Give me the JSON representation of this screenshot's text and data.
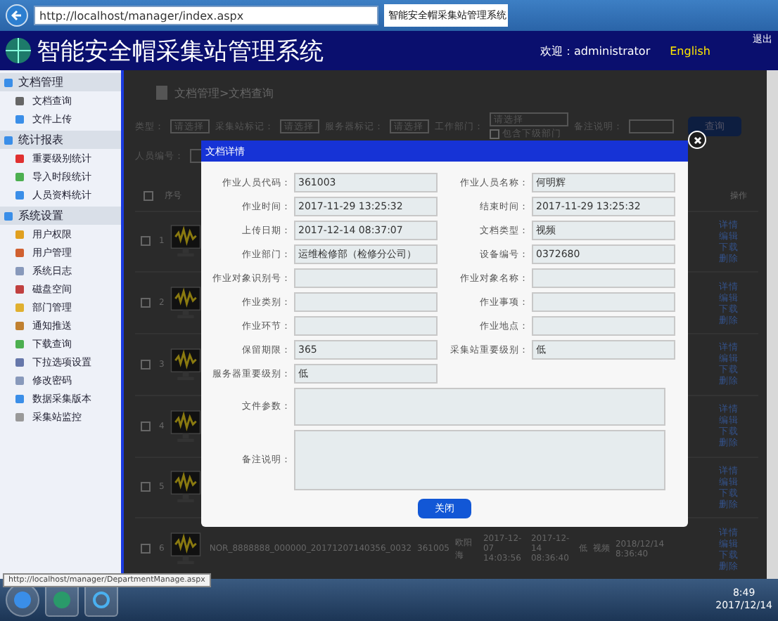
{
  "browser": {
    "address": "http://localhost/manager/index.aspx",
    "tab_title": "智能安全帽采集站管理系统"
  },
  "header": {
    "title": "智能安全帽采集站管理系统",
    "welcome": "欢迎：administrator",
    "language": "English",
    "logout": "退出"
  },
  "sidebar": [
    {
      "label": "文档管理",
      "children": [
        {
          "label": "文档查询"
        },
        {
          "label": "文件上传"
        }
      ]
    },
    {
      "label": "统计报表",
      "children": [
        {
          "label": "重要级别统计"
        },
        {
          "label": "导入时段统计"
        },
        {
          "label": "人员资料统计"
        }
      ]
    },
    {
      "label": "系统设置",
      "children": [
        {
          "label": "用户权限"
        },
        {
          "label": "用户管理"
        },
        {
          "label": "系统日志"
        },
        {
          "label": "磁盘空间"
        },
        {
          "label": "部门管理"
        },
        {
          "label": "通知推送"
        },
        {
          "label": "下载查询"
        },
        {
          "label": "下拉选项设置"
        },
        {
          "label": "修改密码"
        },
        {
          "label": "数据采集版本"
        },
        {
          "label": "采集站监控"
        }
      ]
    }
  ],
  "breadcrumb": "文档管理>文档查询",
  "filters": [
    {
      "label": "类型：",
      "value": "请选择"
    },
    {
      "label": "采集站标记：",
      "value": "请选择"
    },
    {
      "label": "服务器标记：",
      "value": "请选择"
    },
    {
      "label": "工作部门：",
      "value": "请选择"
    }
  ],
  "include_sub": {
    "label": "包含下级部门",
    "checked": false
  },
  "remark_filter": {
    "label": "备注说明："
  },
  "query_button": "查询",
  "person_filter": {
    "label": "人员编号："
  },
  "table": {
    "columns": [
      "序号",
      "操作"
    ],
    "all_selected": false,
    "rows": [
      {
        "index": "1",
        "selected": false,
        "actions": [
          "详情",
          "编辑",
          "下载",
          "删除"
        ]
      },
      {
        "index": "2",
        "selected": false,
        "actions": [
          "详情",
          "编辑",
          "下载",
          "删除"
        ]
      },
      {
        "index": "3",
        "selected": false,
        "actions": [
          "详情",
          "编辑",
          "下载",
          "删除"
        ]
      },
      {
        "index": "4",
        "selected": false,
        "actions": [
          "详情",
          "编辑",
          "下载",
          "删除"
        ]
      },
      {
        "index": "5",
        "selected": false,
        "actions": [
          "详情",
          "编辑",
          "下载",
          "删除"
        ]
      },
      {
        "index": "6",
        "selected": false,
        "cells": [
          "NOR_8888888_000000_20171207140356_0032",
          "361005",
          "欧阳海",
          "2017-12-07 14:03:56",
          "2017-12-14 08:36:40",
          "低",
          "视频",
          "2018/12/14 8:36:40"
        ],
        "actions": [
          "详情",
          "编辑",
          "下载",
          "删除"
        ]
      }
    ]
  },
  "dialog": {
    "title": "文档详情",
    "fields": [
      {
        "kind": "half",
        "label": "作业人员代码：",
        "value": "361003"
      },
      {
        "kind": "half",
        "label": "作业人员名称：",
        "value": "何明辉"
      },
      {
        "kind": "half",
        "label": "作业时间：",
        "value": "2017-11-29 13:25:32"
      },
      {
        "kind": "half",
        "label": "结束时间：",
        "value": "2017-11-29 13:25:32"
      },
      {
        "kind": "half",
        "label": "上传日期：",
        "value": "2017-12-14 08:37:07"
      },
      {
        "kind": "half",
        "label": "文档类型：",
        "value": "视频"
      },
      {
        "kind": "half",
        "label": "作业部门：",
        "value": "运维检修部（检修分公司）"
      },
      {
        "kind": "half",
        "label": "设备编号：",
        "value": "0372680"
      },
      {
        "kind": "half",
        "label": "作业对象识别号："
      },
      {
        "kind": "half",
        "label": "作业对象名称："
      },
      {
        "kind": "half",
        "label": "作业类别："
      },
      {
        "kind": "half",
        "label": "作业事项："
      },
      {
        "kind": "half",
        "label": "作业环节："
      },
      {
        "kind": "half",
        "label": "作业地点："
      },
      {
        "kind": "half",
        "label": "保留期限：",
        "value": "365"
      },
      {
        "kind": "half",
        "label": "采集站重要级别：",
        "value": "低"
      },
      {
        "kind": "half",
        "label": "服务器重要级别：",
        "value": "低"
      },
      {
        "kind": "wide",
        "label": "文件参数："
      },
      {
        "kind": "tall",
        "label": "备注说明："
      }
    ],
    "close_button": "关闭"
  },
  "status_tooltip": "http://localhost/manager/DepartmentManage.aspx",
  "taskbar": {
    "time": "8:49",
    "date": "2017/12/14"
  }
}
